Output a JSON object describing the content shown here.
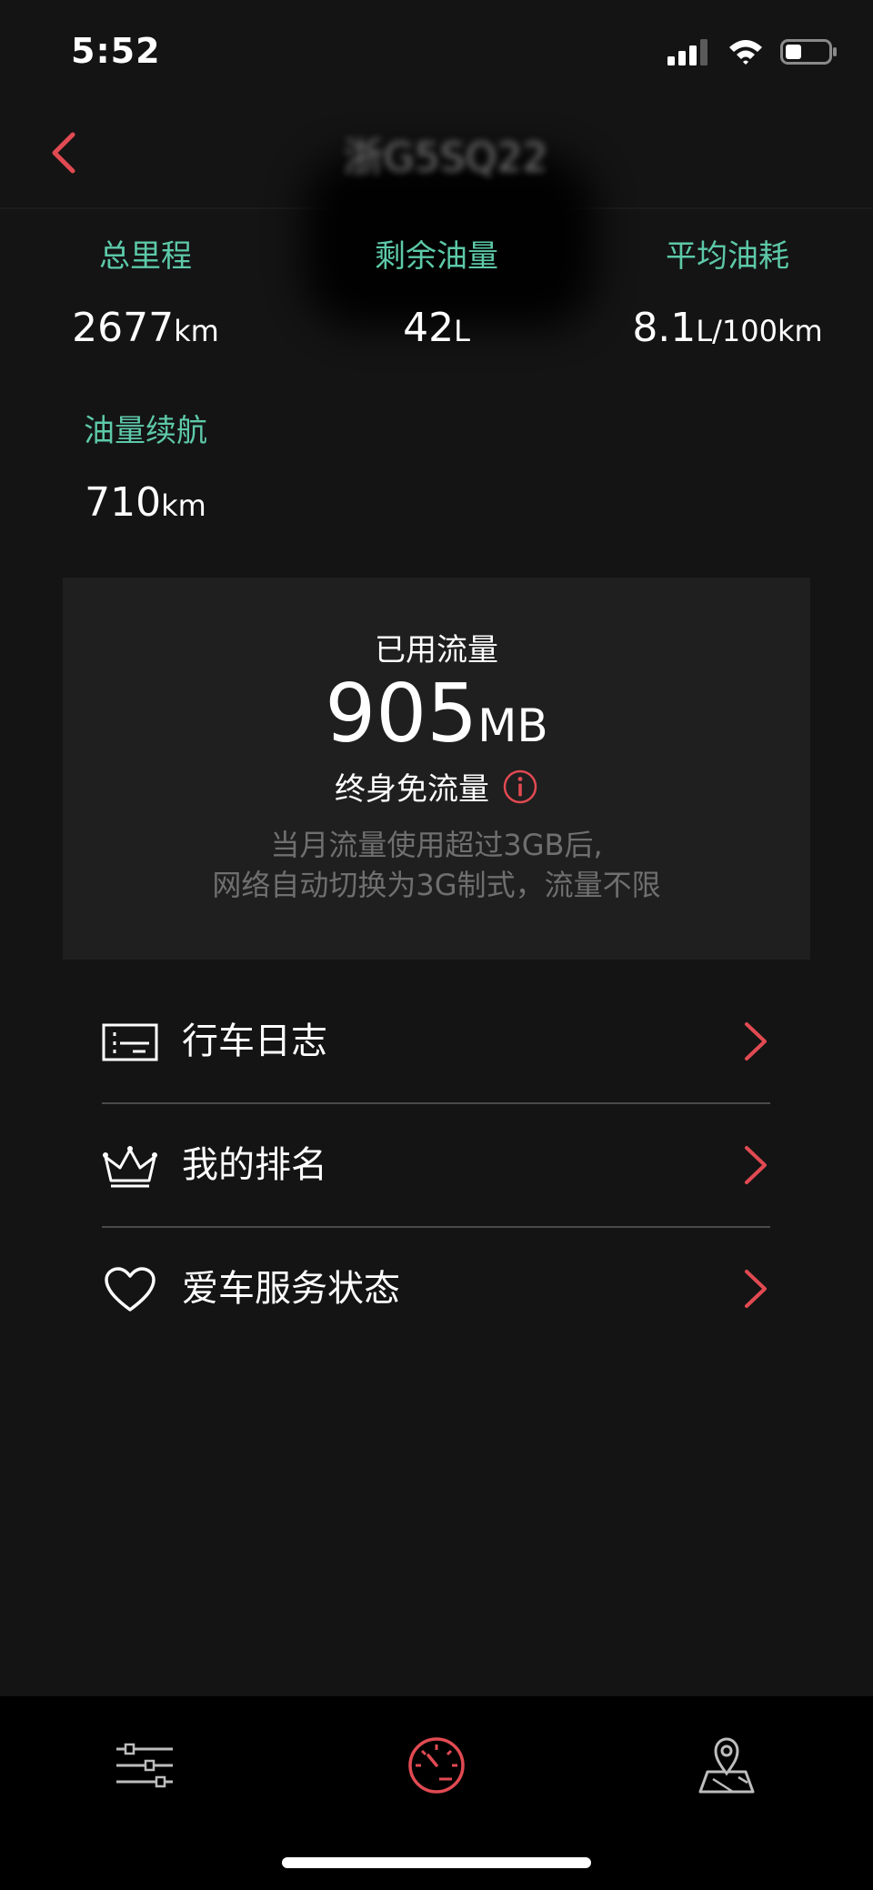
{
  "status_bar": {
    "time": "5:52",
    "icons": [
      "signal-icon",
      "wifi-icon",
      "battery-icon"
    ]
  },
  "nav": {
    "back_icon": "chevron-left-icon",
    "title": "浙G5SQ22"
  },
  "stats": [
    {
      "label": "总里程",
      "value": "2677",
      "unit": "km"
    },
    {
      "label": "剩余油量",
      "value": "42",
      "unit": "L"
    },
    {
      "label": "平均油耗",
      "value": "8.1",
      "unit": "L/100km"
    },
    {
      "label": "油量续航",
      "value": "710",
      "unit": "km"
    }
  ],
  "data_card": {
    "label": "已用流量",
    "value": "905",
    "unit": "MB",
    "free_label": "终身免流量",
    "info_icon": "info-icon",
    "note_line1": "当月流量使用超过3GB后,",
    "note_line2": "网络自动切换为3G制式，流量不限"
  },
  "menu": [
    {
      "label": "行车日志",
      "icon": "logbook-icon"
    },
    {
      "label": "我的排名",
      "icon": "crown-icon"
    },
    {
      "label": "爱车服务状态",
      "icon": "heart-icon"
    }
  ],
  "tab_bar": {
    "tabs": [
      "sliders-icon",
      "speedometer-icon",
      "map-pin-icon"
    ],
    "active_index": 1
  },
  "colors": {
    "accent": "#e14a52",
    "stat_label": "#5dc9a8",
    "background": "#141414",
    "card": "#1f1f1f",
    "tab_bar": "#000000"
  }
}
